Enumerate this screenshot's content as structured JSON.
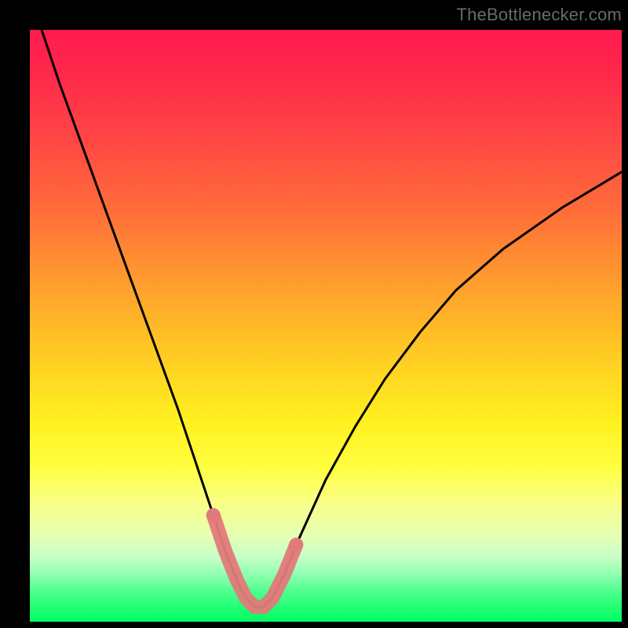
{
  "watermark": "TheBottlenecker.com",
  "chart_data": {
    "type": "line",
    "title": "",
    "xlabel": "",
    "ylabel": "",
    "xlim": [
      0,
      100
    ],
    "ylim": [
      0,
      100
    ],
    "grid": false,
    "legend": false,
    "series": [
      {
        "name": "bottleneck-curve",
        "color": "#000000",
        "x": [
          2,
          5,
          9,
          13,
          17,
          21,
          25,
          29,
          31,
          33,
          35,
          36.5,
          38,
          39.5,
          41,
          43,
          45,
          50,
          55,
          60,
          66,
          72,
          80,
          90,
          100
        ],
        "y": [
          100,
          91,
          80,
          69,
          58,
          47,
          36,
          24,
          18,
          12,
          7,
          4,
          2.5,
          2.5,
          4,
          8,
          13,
          24,
          33,
          41,
          49,
          56,
          63,
          70,
          76
        ]
      }
    ],
    "markers": [
      {
        "name": "highlighted-segment",
        "color": "#e17a7a",
        "stroke_width": 18,
        "x": [
          31,
          33,
          35,
          36.5,
          38,
          39.5,
          41,
          43,
          45
        ],
        "y": [
          18,
          12,
          7,
          4,
          2.5,
          2.5,
          4,
          8,
          13
        ]
      }
    ]
  }
}
